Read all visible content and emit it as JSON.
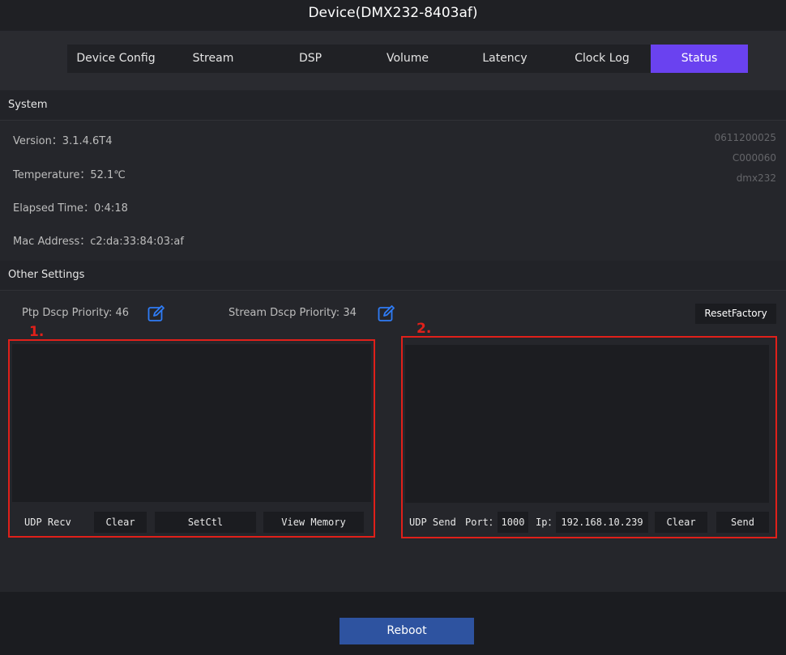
{
  "window": {
    "title": "Device(DMX232-8403af)"
  },
  "tabs": [
    {
      "label": "Device Config",
      "active": false
    },
    {
      "label": "Stream",
      "active": false
    },
    {
      "label": "DSP",
      "active": false
    },
    {
      "label": "Volume",
      "active": false
    },
    {
      "label": "Latency",
      "active": false
    },
    {
      "label": "Clock Log",
      "active": false
    },
    {
      "label": "Status",
      "active": true
    }
  ],
  "system": {
    "heading": "System",
    "version": "Version：3.1.4.6T4",
    "temperature": "Temperature：52.1℃",
    "elapsed": "Elapsed Time：0:4:18",
    "mac": "Mac Address：c2:da:33:84:03:af",
    "right_info": [
      "0611200025",
      "C000060",
      "dmx232"
    ]
  },
  "other_settings": {
    "heading": "Other Settings",
    "ptp_priority": "Ptp Dscp Priority: 46",
    "stream_priority": "Stream Dscp Priority: 34",
    "reset_factory": "ResetFactory"
  },
  "annotations": {
    "box1": "1.",
    "box2": "2."
  },
  "udp_recv": {
    "label": "UDP Recv",
    "clear": "Clear",
    "setctl": "SetCtl",
    "view_memory": "View Memory"
  },
  "udp_send": {
    "label": "UDP Send",
    "port_label": "Port：",
    "port_value": "1000",
    "ip_label": "Ip：",
    "ip_value": "192.168.10.239",
    "clear": "Clear",
    "send": "Send"
  },
  "footer": {
    "reboot": "Reboot"
  },
  "colors": {
    "accent_tab": "#6a42f0",
    "reboot_button": "#2e53a0",
    "annotation_red": "#e0201a",
    "edit_icon": "#2f7cf6"
  }
}
